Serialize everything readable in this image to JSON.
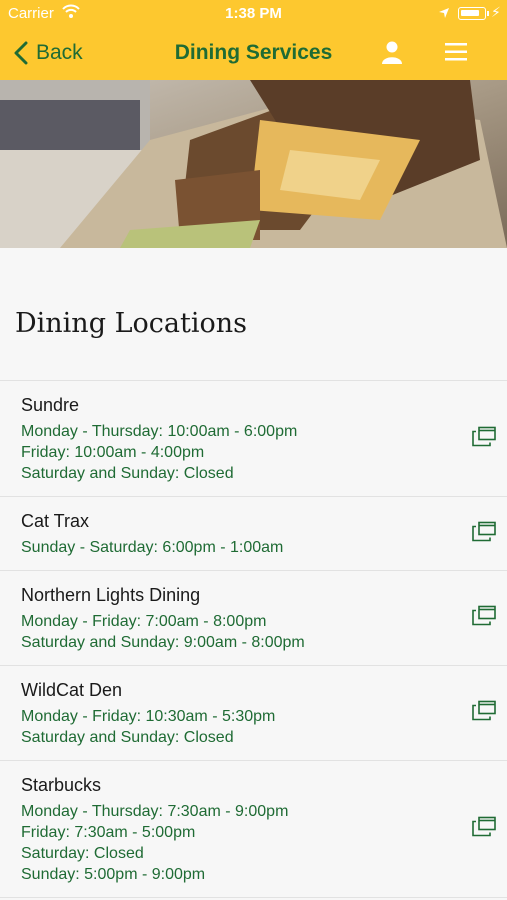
{
  "status_bar": {
    "carrier": "Carrier",
    "time": "1:38 PM"
  },
  "nav": {
    "back_label": "Back",
    "title": "Dining Services"
  },
  "section": {
    "title": "Dining Locations"
  },
  "locations": [
    {
      "name": "Sundre",
      "hours": [
        "Monday - Thursday: 10:00am - 6:00pm",
        "Friday: 10:00am - 4:00pm",
        "Saturday and Sunday: Closed"
      ]
    },
    {
      "name": "Cat Trax",
      "hours": [
        "Sunday - Saturday: 6:00pm - 1:00am"
      ]
    },
    {
      "name": "Northern Lights Dining",
      "hours": [
        "Monday - Friday: 7:00am - 8:00pm",
        "Saturday and Sunday: 9:00am - 8:00pm"
      ]
    },
    {
      "name": "WildCat Den",
      "hours": [
        "Monday - Friday: 10:30am - 5:30pm",
        "Saturday and Sunday: Closed"
      ]
    },
    {
      "name": "Starbucks",
      "hours": [
        "Monday - Thursday: 7:30am - 9:00pm",
        "Friday: 7:30am - 5:00pm",
        "Saturday: Closed",
        "Sunday: 5:00pm - 9:00pm"
      ]
    }
  ],
  "colors": {
    "brand_yellow": "#fdc82f",
    "brand_green": "#1f6b34"
  },
  "icons": {
    "back": "chevron-left-icon",
    "user": "user-icon",
    "menu": "hamburger-menu-icon",
    "external": "external-window-icon"
  }
}
